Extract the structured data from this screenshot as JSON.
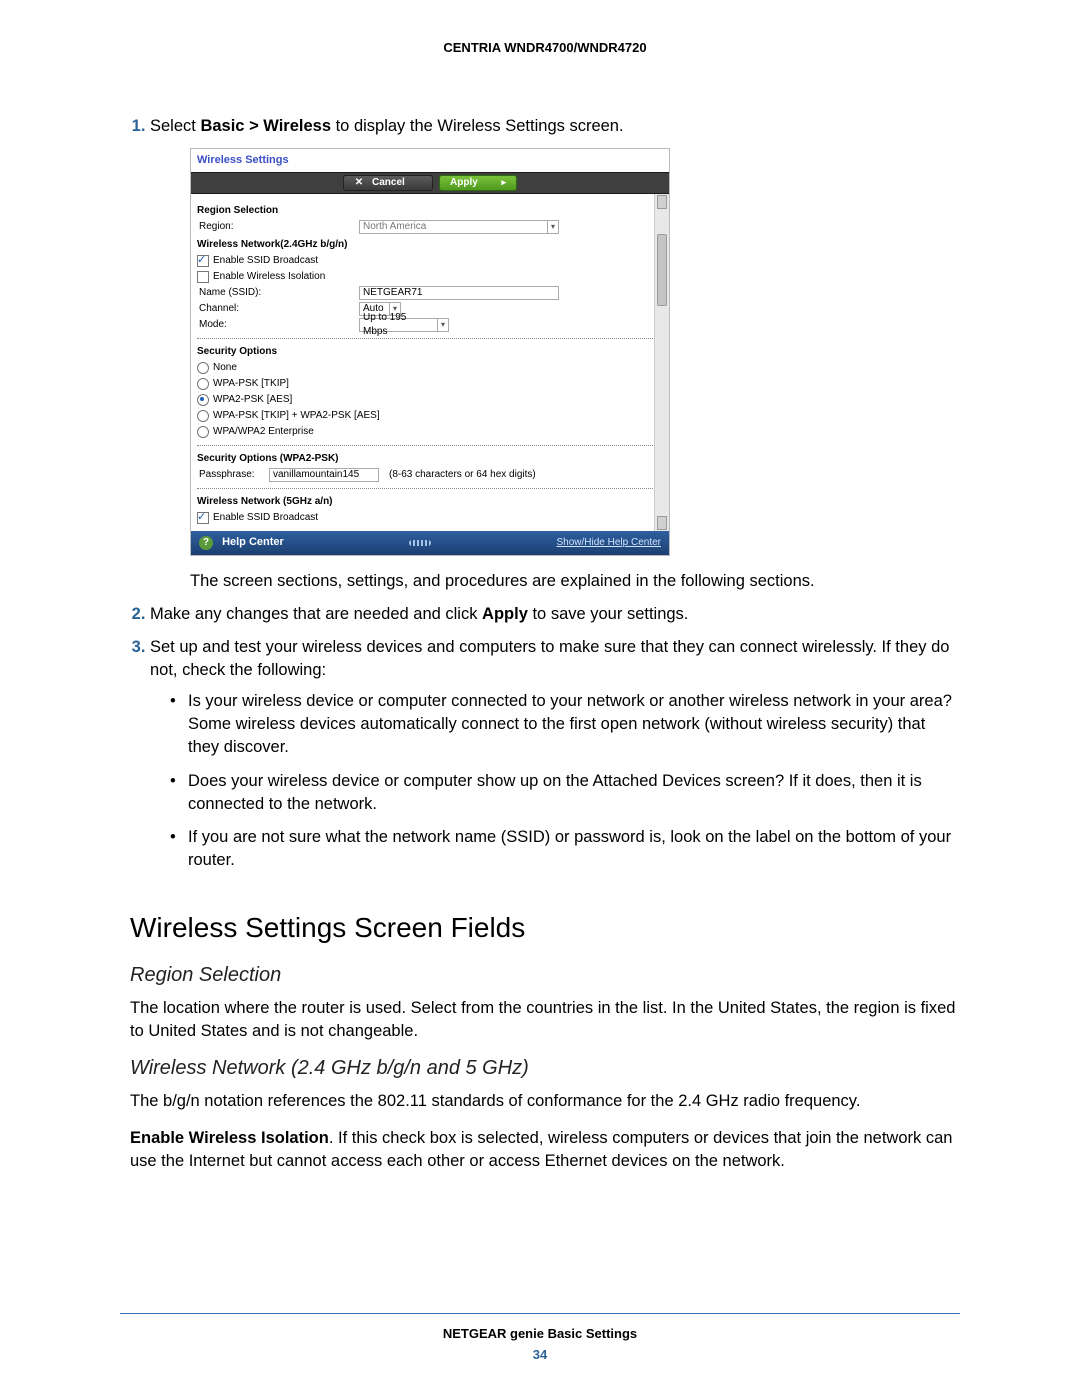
{
  "header": {
    "title": "CENTRIA WNDR4700/WNDR4720"
  },
  "steps": {
    "s1_pre": "Select ",
    "s1_bold": "Basic > Wireless",
    "s1_post": " to display the Wireless Settings screen.",
    "s1_after": "The screen sections, settings, and procedures are explained in the following sections.",
    "s2_pre": "Make any changes that are needed and click ",
    "s2_bold": "Apply",
    "s2_post": " to save your settings.",
    "s3": "Set up and test your wireless devices and computers to make sure that they can connect wirelessly. If they do not, check the following:",
    "s3_b1": "Is your wireless device or computer connected to your network or another wireless network in your area? Some wireless devices automatically connect to the first open network (without wireless security) that they discover.",
    "s3_b2": "Does your wireless device or computer show up on the Attached Devices screen? If it does, then it is connected to the network.",
    "s3_b3": "If you are not sure what the network name (SSID) or password is, look on the label on the bottom of your router."
  },
  "section": {
    "h2": "Wireless Settings Screen Fields",
    "h3a": "Region Selection",
    "pa": "The location where the router is used. Select from the countries in the list. In the United States, the region is fixed to United States and is not changeable.",
    "h3b": "Wireless Network (2.4 GHz b/g/n and 5 GHz)",
    "pb1": "The b/g/n notation references the 802.11 standards of conformance for the 2.4 GHz radio frequency.",
    "pb2_bold": "Enable Wireless Isolation",
    "pb2_rest": ". If this check box is selected, wireless computers or devices that join the network can use the Internet but cannot access each other or access Ethernet devices on the network."
  },
  "footer": {
    "title": "NETGEAR genie Basic Settings",
    "page": "34"
  },
  "shot": {
    "title": "Wireless Settings",
    "cancel": "Cancel",
    "apply": "Apply",
    "grp_region_title": "Region Selection",
    "lbl_region": "Region:",
    "val_region": "North America",
    "grp_24_title": "Wireless Network(2.4GHz b/g/n)",
    "cb_ssid_bcast": "Enable SSID Broadcast",
    "cb_isolation": "Enable Wireless Isolation",
    "lbl_name": "Name (SSID):",
    "val_name": "NETGEAR71",
    "lbl_channel": "Channel:",
    "val_channel": "Auto",
    "lbl_mode": "Mode:",
    "val_mode": "Up to 195 Mbps",
    "grp_sec_title": "Security Options",
    "opt_none": "None",
    "opt_wpa_tkip": "WPA-PSK [TKIP]",
    "opt_wpa2_aes": "WPA2-PSK [AES]",
    "opt_wpa_both": "WPA-PSK [TKIP] + WPA2-PSK [AES]",
    "opt_enterprise": "WPA/WPA2 Enterprise",
    "grp_sec2_title": "Security Options (WPA2-PSK)",
    "lbl_pass": "Passphrase:",
    "val_pass": "vanillamountain145",
    "hint_pass": "(8-63 characters or 64 hex digits)",
    "grp_5_title": "Wireless Network (5GHz a/n)",
    "helpcenter": "Help Center",
    "helplink": "Show/Hide Help Center"
  }
}
